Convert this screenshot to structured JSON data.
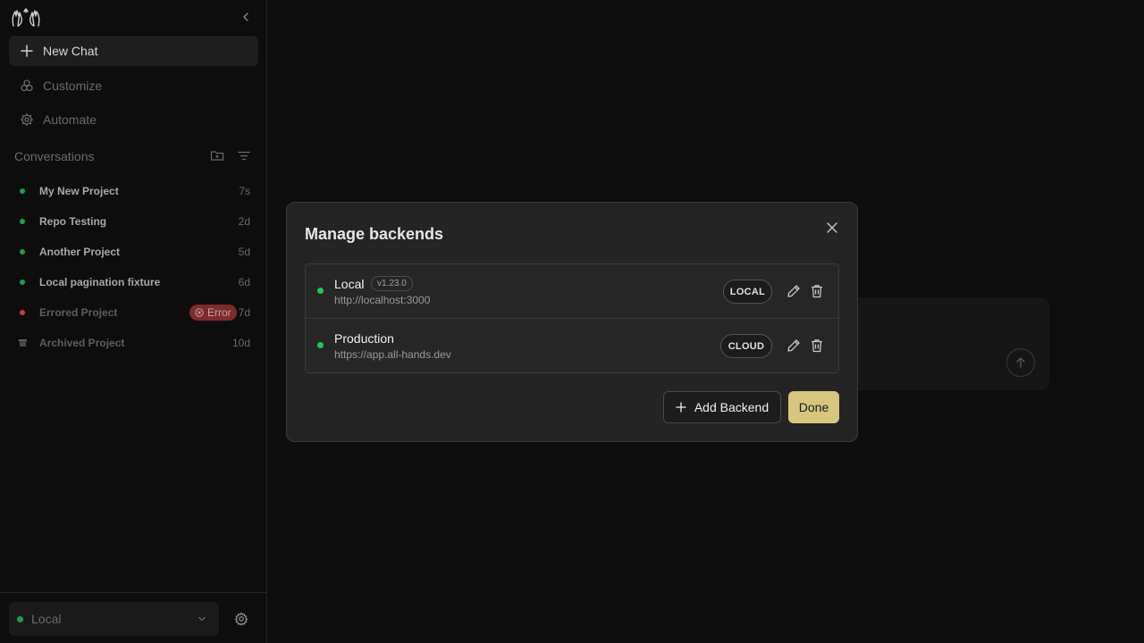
{
  "sidebar": {
    "new_chat": "New Chat",
    "customize": "Customize",
    "automate": "Automate",
    "conversations_title": "Conversations",
    "conversations": [
      {
        "title": "My New Project",
        "time": "7s",
        "status_color": "#1f9d4a"
      },
      {
        "title": "Repo Testing",
        "time": "2d",
        "status_color": "#1f9d4a"
      },
      {
        "title": "Another Project",
        "time": "5d",
        "status_color": "#1f9d4a"
      },
      {
        "title": "Local pagination fixture",
        "time": "6d",
        "status_color": "#1f9d4a"
      },
      {
        "title": "Errored Project",
        "time": "7d",
        "status_color": "#c24141",
        "badge": "Error"
      },
      {
        "title": "Archived Project",
        "time": "10d",
        "archived": true
      }
    ],
    "backend_selector": "Local"
  },
  "modal": {
    "title": "Manage backends",
    "backends": [
      {
        "name": "Local",
        "version": "v1.23.0",
        "url": "http://localhost:3000",
        "type": "LOCAL"
      },
      {
        "name": "Production",
        "url": "https://app.all-hands.dev",
        "type": "CLOUD"
      }
    ],
    "add_label": "Add Backend",
    "done_label": "Done"
  },
  "colors": {
    "accent": "#d7c67d",
    "status_green": "#22c55e",
    "error_red": "#c24141"
  }
}
